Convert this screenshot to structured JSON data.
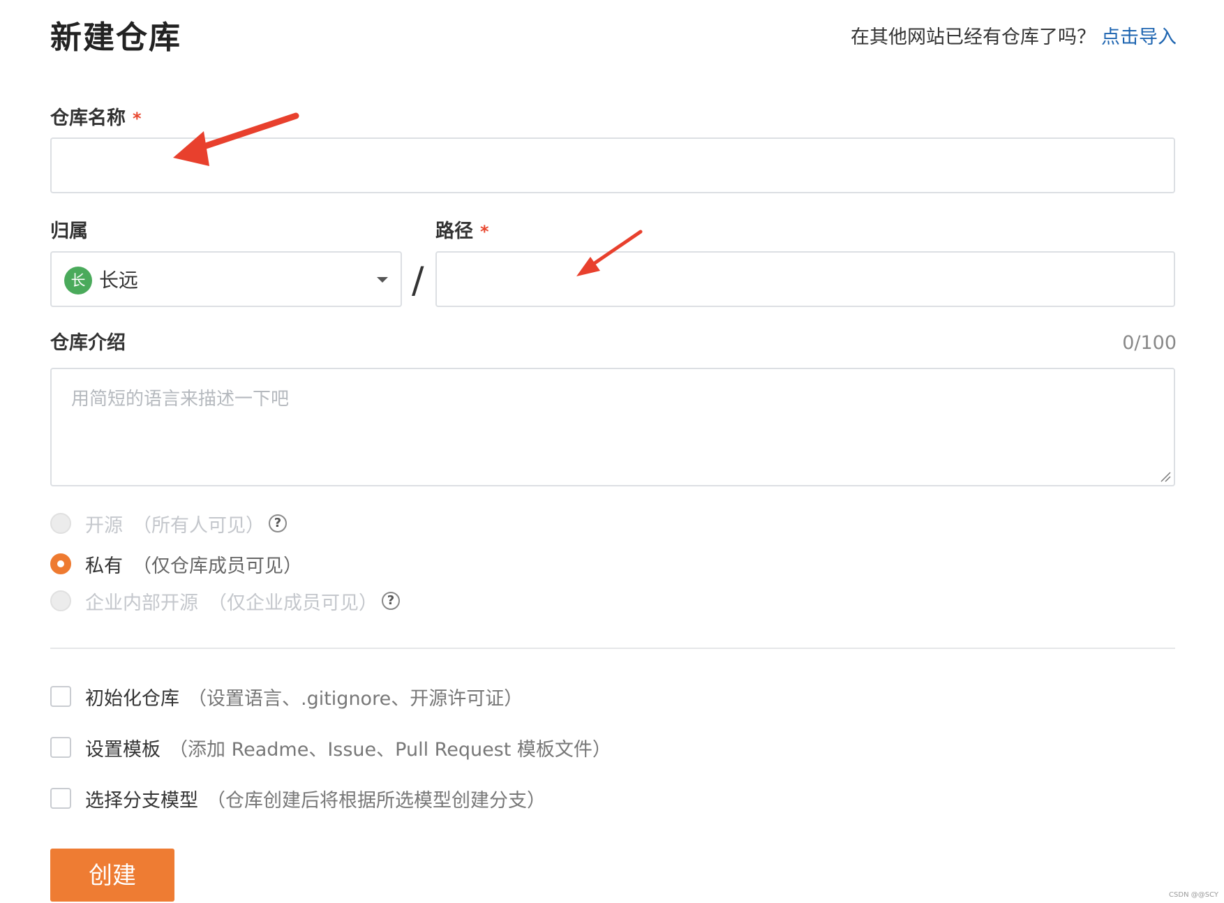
{
  "header": {
    "title": "新建仓库",
    "import_prompt": "在其他网站已经有仓库了吗？",
    "import_link": "点击导入"
  },
  "form": {
    "repo_name": {
      "label": "仓库名称",
      "required_mark": "*",
      "value": ""
    },
    "owner": {
      "label": "归属",
      "avatar_initial": "长",
      "value": "长远",
      "avatar_color": "#4aaa5b"
    },
    "separator": "/",
    "path": {
      "label": "路径",
      "required_mark": "*",
      "value": ""
    },
    "description": {
      "label": "仓库介绍",
      "counter": "0/100",
      "placeholder": "用简短的语言来描述一下吧"
    },
    "visibility": [
      {
        "label": "开源",
        "hint": "（所有人可见）",
        "state": "disabled",
        "help": "?"
      },
      {
        "label": "私有",
        "hint": "（仅仓库成员可见）",
        "state": "checked"
      },
      {
        "label": "企业内部开源",
        "hint": "（仅企业成员可见）",
        "state": "disabled",
        "help": "?"
      }
    ],
    "options": [
      {
        "label": "初始化仓库",
        "hint": "（设置语言、.gitignore、开源许可证）",
        "checked": false
      },
      {
        "label": "设置模板",
        "hint": "（添加 Readme、Issue、Pull Request 模板文件）",
        "checked": false
      },
      {
        "label": "选择分支模型",
        "hint": "（仓库创建后将根据所选模型创建分支）",
        "checked": false
      }
    ],
    "submit_label": "创建"
  },
  "watermark": "CSDN @@SCY",
  "colors": {
    "accent": "#ee7c33",
    "link": "#1d64b0",
    "required": "#e8472f",
    "annotation_arrow": "#e8402d"
  }
}
